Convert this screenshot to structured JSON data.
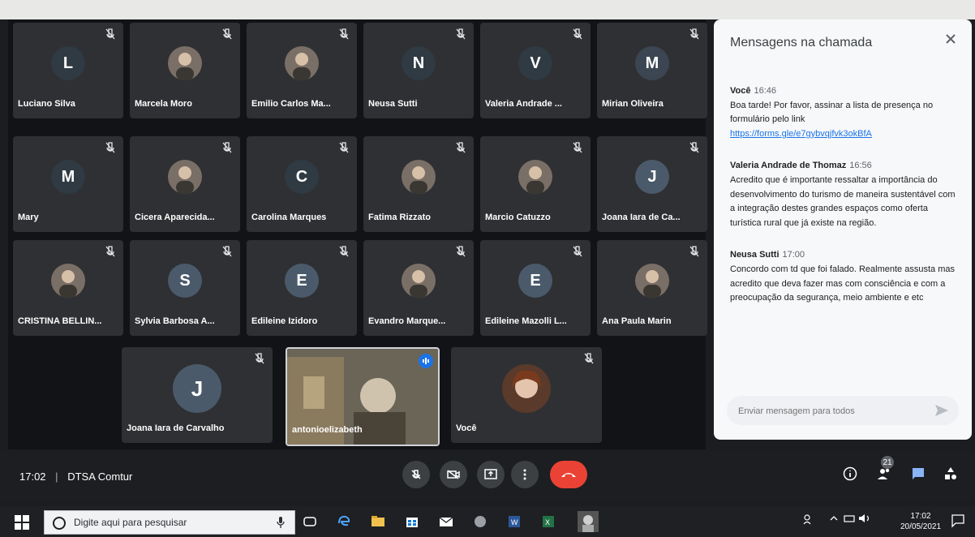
{
  "meeting": {
    "time": "17:02",
    "name": "DTSA Comtur",
    "participants_count": "21"
  },
  "tiles": [
    {
      "name": "Luciano Silva",
      "initial": "L",
      "color": "#2f3a43"
    },
    {
      "name": "Marcela Moro",
      "initial": "",
      "color": ""
    },
    {
      "name": "Emilio Carlos Ma...",
      "initial": "",
      "color": ""
    },
    {
      "name": "Neusa Sutti",
      "initial": "N",
      "color": "#2f3a43"
    },
    {
      "name": "Valeria Andrade ...",
      "initial": "V",
      "color": "#2f3a43"
    },
    {
      "name": "Mirian Oliveira",
      "initial": "M",
      "color": "#3c4652"
    },
    {
      "name": "Mary",
      "initial": "M",
      "color": "#2f3a43"
    },
    {
      "name": "Cicera Aparecida...",
      "initial": "",
      "color": ""
    },
    {
      "name": "Carolina Marques",
      "initial": "C",
      "color": "#2f3a43"
    },
    {
      "name": "Fatima Rizzato",
      "initial": "",
      "color": ""
    },
    {
      "name": "Marcio Catuzzo",
      "initial": "",
      "color": ""
    },
    {
      "name": "Joana Iara de Ca...",
      "initial": "J",
      "color": "#4a5a6a"
    },
    {
      "name": "CRISTINA BELLIN...",
      "initial": "",
      "color": ""
    },
    {
      "name": "Sylvia Barbosa A...",
      "initial": "S",
      "color": "#4a5a6a"
    },
    {
      "name": "Edileine Izidoro",
      "initial": "E",
      "color": "#4a5a6a"
    },
    {
      "name": "Evandro Marque...",
      "initial": "",
      "color": ""
    },
    {
      "name": "Edileine Mazolli L...",
      "initial": "E",
      "color": "#4a5a6a"
    },
    {
      "name": "Ana Paula Marin",
      "initial": "",
      "color": ""
    }
  ],
  "bottom_tiles": [
    {
      "name": "Joana Iara de Carvalho",
      "initial": "J"
    },
    {
      "name": "antonioelizabeth"
    },
    {
      "name": "Você"
    }
  ],
  "chat": {
    "title": "Mensagens na chamada",
    "messages": [
      {
        "sender": "Você",
        "time": "16:46",
        "text": "Boa tarde! Por favor, assinar a lista de presença no formulário pelo link",
        "link": "https://forms.gle/e7gybvqjfvk3okBfA"
      },
      {
        "sender": "Valeria Andrade de Thomaz",
        "time": "16:56",
        "text": "Acredito que é importante ressaltar a importância do desenvolvimento do turismo de maneira sustentável com a integração destes grandes espaços como oferta turística rural que já existe na região."
      },
      {
        "sender": "Neusa Sutti",
        "time": "17:00",
        "text": "Concordo com td que foi falado. Realmente assusta mas acredito que deva fazer mas com consciência e com a preocupação da segurança, meio ambiente e etc"
      }
    ],
    "placeholder": "Enviar mensagem para todos"
  },
  "taskbar": {
    "search_placeholder": "Digite aqui para pesquisar",
    "clock_time": "17:02",
    "clock_date": "20/05/2021"
  },
  "colors": {
    "end_call": "#ea4335",
    "link": "#1a73e8"
  }
}
